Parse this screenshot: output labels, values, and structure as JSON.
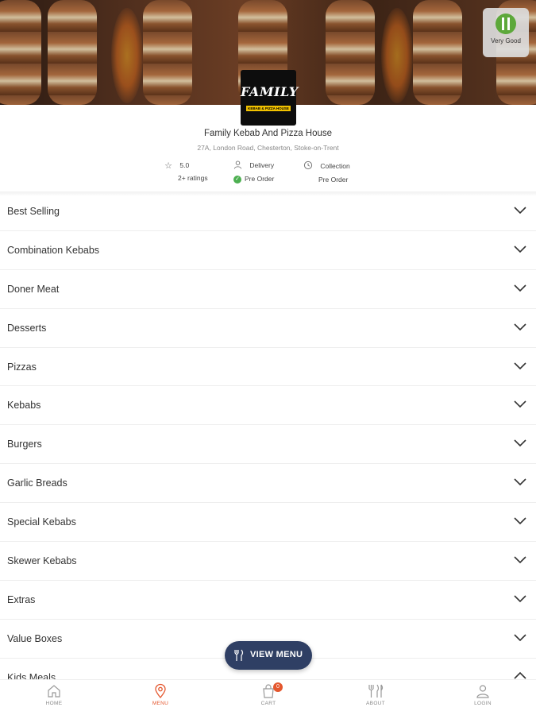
{
  "restaurant": {
    "logo_title": "FAMILY",
    "logo_subtitle": "KEBAB & PIZZA HOUSE",
    "name": "Family Kebab And Pizza House",
    "address": "27A, London Road, Chesterton, Stoke-on-Trent",
    "hygiene_rating_label": "Very Good"
  },
  "info": {
    "rating": "5.0",
    "ratings_count": "2+ ratings",
    "delivery_label": "Delivery",
    "delivery_status": "Pre Order",
    "collection_label": "Collection",
    "collection_status": "Pre Order"
  },
  "categories": [
    {
      "label": "Best Selling",
      "expanded": false
    },
    {
      "label": "Combination Kebabs",
      "expanded": false
    },
    {
      "label": "Doner Meat",
      "expanded": false
    },
    {
      "label": "Desserts",
      "expanded": false
    },
    {
      "label": "Pizzas",
      "expanded": false
    },
    {
      "label": "Kebabs",
      "expanded": false
    },
    {
      "label": "Burgers",
      "expanded": false
    },
    {
      "label": "Garlic Breads",
      "expanded": false
    },
    {
      "label": "Special Kebabs",
      "expanded": false
    },
    {
      "label": "Skewer Kebabs",
      "expanded": false
    },
    {
      "label": "Extras",
      "expanded": false
    },
    {
      "label": "Value Boxes",
      "expanded": false
    },
    {
      "label": "Kids Meals",
      "expanded": true
    }
  ],
  "view_menu_label": "VIEW MENU",
  "nav": {
    "home": "HOME",
    "menu": "MENU",
    "cart": "CART",
    "cart_count": "0",
    "about": "ABOUT",
    "login": "LOGIN",
    "active": "menu"
  },
  "colors": {
    "accent": "#e4572e",
    "view_menu_bg": "#2f3f64",
    "check_green": "#4caf50"
  }
}
